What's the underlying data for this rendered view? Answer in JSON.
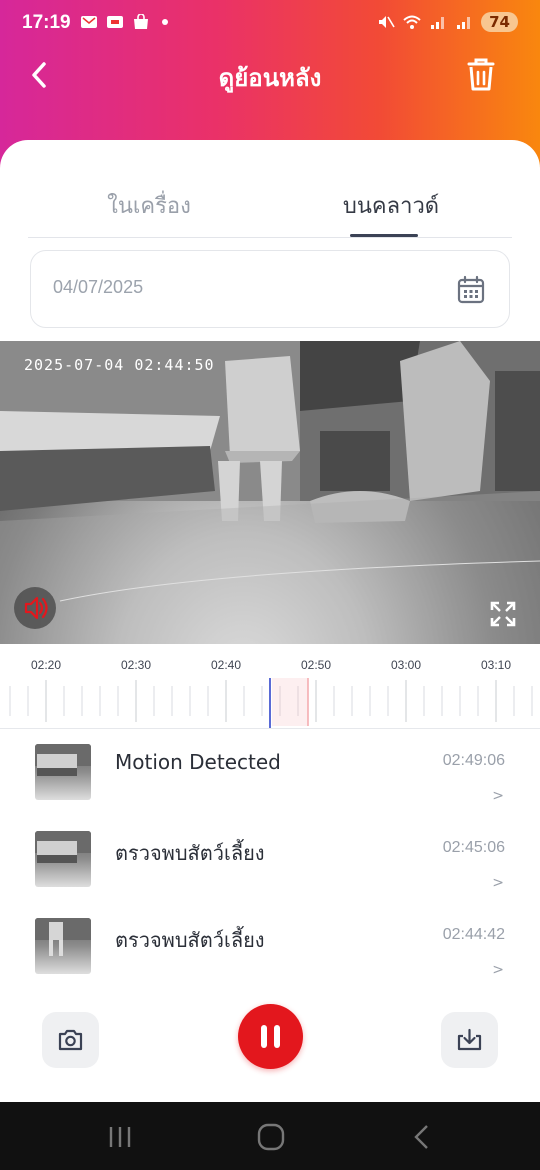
{
  "status_bar": {
    "time": "17:19",
    "battery": "74",
    "left_icons": [
      "message-icon",
      "sim-icon",
      "shopping-bag-icon",
      "notification-dot-icon"
    ],
    "right_icons": [
      "mute-icon",
      "wifi-icon",
      "signal-icon",
      "signal-icon"
    ]
  },
  "header": {
    "title": "ดูย้อนหลัง",
    "back_icon": "chevron-left-icon",
    "delete_icon": "trash-icon"
  },
  "tabs": [
    {
      "label": "ในเครื่อง",
      "active": false
    },
    {
      "label": "บนคลาวด์",
      "active": true
    }
  ],
  "date_picker": {
    "value": "04/07/2025",
    "icon": "calendar-icon"
  },
  "video": {
    "timestamp": "2025-07-04 02:44:50",
    "mute_icon": "speaker-muted-icon",
    "fullscreen_icon": "fullscreen-icon"
  },
  "timeline": {
    "labels": [
      "02:20",
      "02:30",
      "02:40",
      "02:50",
      "03:00",
      "03:10"
    ],
    "cursor_color": "#5a6bd6",
    "event_marker_color": "#f4a9ac"
  },
  "events": [
    {
      "title": "Motion Detected",
      "time": "02:49:06",
      "chevron": ">"
    },
    {
      "title": "ตรวจพบสัตว์เลี้ยง",
      "time": "02:45:06",
      "chevron": ">"
    },
    {
      "title": "ตรวจพบสัตว์เลี้ยง",
      "time": "02:44:42",
      "chevron": ">"
    }
  ],
  "controls": {
    "snapshot_icon": "camera-icon",
    "pause_icon": "pause-icon",
    "download_icon": "download-icon",
    "accent_color": "#e3171d"
  },
  "navbar": {
    "icons": [
      "recent-apps-icon",
      "home-icon",
      "back-icon"
    ]
  }
}
